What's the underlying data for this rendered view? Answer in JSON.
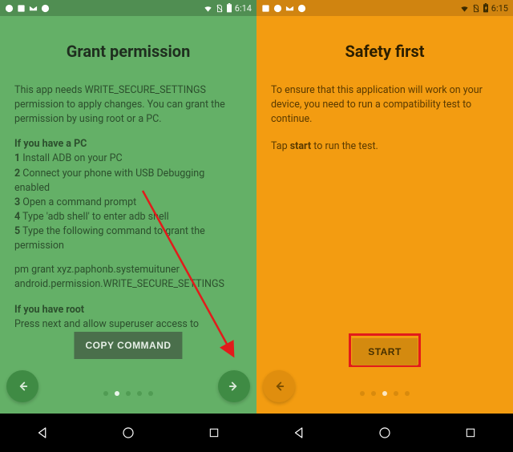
{
  "left": {
    "status": {
      "clock": "6:14"
    },
    "title": "Grant permission",
    "intro": "This app needs WRITE_SECURE_SETTINGS permission to apply changes. You can grant the permission by using root or a PC.",
    "pc_heading": "If you have a PC",
    "steps": {
      "s1": "Install ADB on your PC",
      "s2": "Connect your phone with USB Debugging enabled",
      "s3": "Open a command prompt",
      "s4": "Type 'adb shell' to enter adb shell",
      "s5": "Type the following command to grant the permission"
    },
    "command": "pm grant xyz.paphonb.systemuituner android.permission.WRITE_SECURE_SETTINGS",
    "root_heading": "If you have root",
    "root_body": "Press next and allow superuser access to",
    "copy_label": "COPY COMMAND",
    "page_count": 5,
    "active_page": 1
  },
  "right": {
    "status": {
      "clock": "6:15"
    },
    "title": "Safety first",
    "para1": "To ensure that this application will work on your device, you need to run a compatibility test to continue.",
    "para2_prefix": "Tap ",
    "para2_bold": "start",
    "para2_suffix": " to run the test.",
    "start_label": "START",
    "page_count": 5,
    "active_page": 2
  }
}
